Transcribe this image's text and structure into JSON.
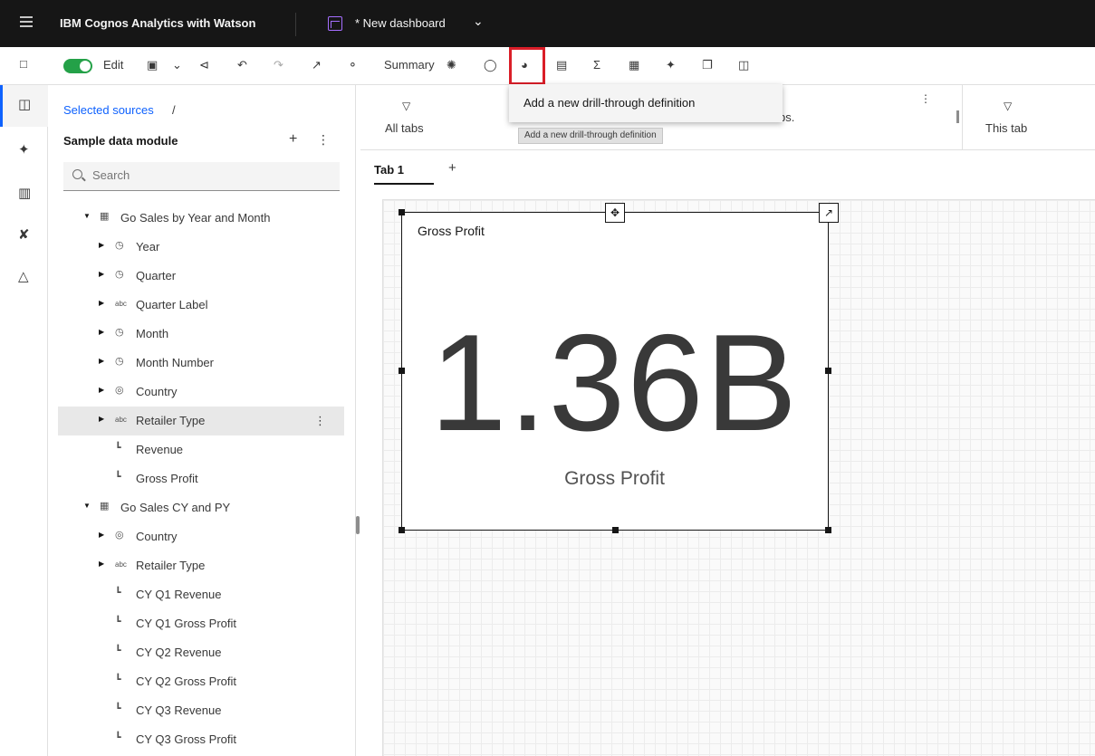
{
  "header": {
    "app_title": "IBM Cognos Analytics with Watson",
    "dashboard_title": "* New dashboard"
  },
  "toolbar": {
    "edit_label": "Edit",
    "summary_label": "Summary"
  },
  "sources": {
    "breadcrumb": "Selected sources",
    "breadcrumb_sep": "/",
    "module_name": "Sample data module",
    "search_placeholder": "Search",
    "tree": [
      {
        "label": "Go Sales by Year and Month",
        "icon": "table-icon",
        "level": 0,
        "expanded": true
      },
      {
        "label": "Year",
        "icon": "clock-icon",
        "level": 1,
        "expandable": true
      },
      {
        "label": "Quarter",
        "icon": "clock-icon",
        "level": 1,
        "expandable": true
      },
      {
        "label": "Quarter Label",
        "icon": "text-icon",
        "level": 1,
        "expandable": true
      },
      {
        "label": "Month",
        "icon": "clock-icon",
        "level": 1,
        "expandable": true
      },
      {
        "label": "Month Number",
        "icon": "clock-icon",
        "level": 1,
        "expandable": true
      },
      {
        "label": "Country",
        "icon": "location-icon",
        "level": 1,
        "expandable": true
      },
      {
        "label": "Retailer Type",
        "icon": "text-icon",
        "level": 1,
        "expandable": true,
        "selected": true
      },
      {
        "label": "Revenue",
        "icon": "measure-icon",
        "level": 1
      },
      {
        "label": "Gross Profit",
        "icon": "measure-icon",
        "level": 1
      },
      {
        "label": "Go Sales CY and PY",
        "icon": "table-icon",
        "level": 0,
        "expanded": true
      },
      {
        "label": "Country",
        "icon": "location-icon",
        "level": 1,
        "expandable": true
      },
      {
        "label": "Retailer Type",
        "icon": "text-icon",
        "level": 1,
        "expandable": true
      },
      {
        "label": "CY Q1 Revenue",
        "icon": "measure-icon",
        "level": 1
      },
      {
        "label": "CY Q1 Gross Profit",
        "icon": "measure-icon",
        "level": 1
      },
      {
        "label": "CY Q2 Revenue",
        "icon": "measure-icon",
        "level": 1
      },
      {
        "label": "CY Q2 Gross Profit",
        "icon": "measure-icon",
        "level": 1
      },
      {
        "label": "CY Q3 Revenue",
        "icon": "measure-icon",
        "level": 1
      },
      {
        "label": "CY Q3 Gross Profit",
        "icon": "measure-icon",
        "level": 1
      }
    ]
  },
  "filters": {
    "all_tabs_label": "All tabs",
    "partial_text": "bs.",
    "this_tab_label": "This tab"
  },
  "tabs": {
    "tab1_label": "Tab 1",
    "add_label": "+"
  },
  "widget": {
    "title": "Gross Profit",
    "value": "1.36B",
    "label": "Gross Profit"
  },
  "drill_menu": {
    "item_label": "Add a new drill-through definition",
    "tooltip": "Add a new drill-through definition"
  },
  "colors": {
    "header_bg": "#161616",
    "toggle_on": "#24a148",
    "link_blue": "#0f62fe",
    "highlight_red": "#da1e28"
  }
}
